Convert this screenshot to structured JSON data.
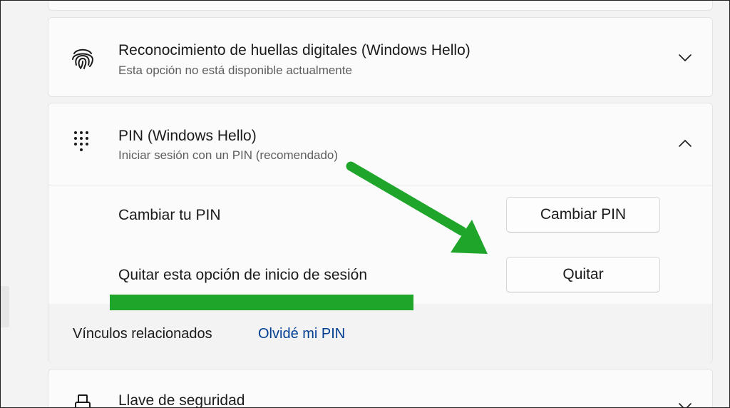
{
  "fingerprint": {
    "title": "Reconocimiento de huellas digitales (Windows Hello)",
    "subtitle": "Esta opción no está disponible actualmente",
    "icon": "fingerprint-icon"
  },
  "pin": {
    "title": "PIN (Windows Hello)",
    "subtitle": "Iniciar sesión con un PIN (recomendado)",
    "icon": "keypad-icon",
    "expanded": true,
    "change_label": "Cambiar tu PIN",
    "change_button": "Cambiar PIN",
    "remove_label": "Quitar esta opción de inicio de sesión",
    "remove_button": "Quitar",
    "related_label": "Vínculos relacionados",
    "related_link": "Olvidé mi PIN"
  },
  "security_key": {
    "title": "Llave de seguridad",
    "icon": "usb-key-icon"
  },
  "colors": {
    "annotation": "#1ea52a",
    "link": "#003e92"
  }
}
